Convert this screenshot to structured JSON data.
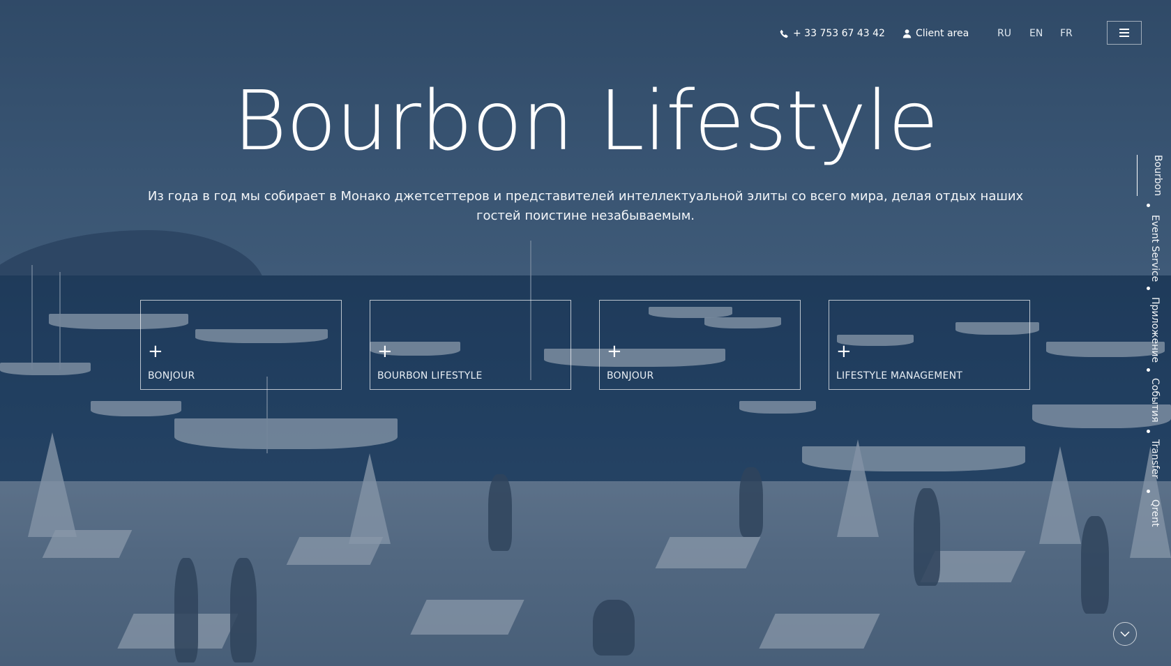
{
  "header": {
    "phone": "+ 33 753 67 43 42",
    "client_area": "Client area",
    "languages": [
      "RU",
      "EN",
      "FR"
    ]
  },
  "hero": {
    "title": "Bourbon Lifestyle",
    "subtitle": "Из года в год мы собирает в Монако джетсеттеров и представителей интеллектуальной элиты со всего мира, делая отдых наших гостей поистине незабываемым."
  },
  "cards": [
    {
      "plus": "+",
      "label": "BONJOUR"
    },
    {
      "plus": "+",
      "label": "BOURBON LIFESTYLE"
    },
    {
      "plus": "+",
      "label": "BONJOUR"
    },
    {
      "plus": "+",
      "label": "LIFESTYLE MANAGEMENT"
    }
  ],
  "sidenav": {
    "items": [
      "Bourbon",
      "Event Service",
      "Приложение",
      "События",
      "Transfer",
      "Qrent"
    ],
    "active": "Bourbon"
  },
  "icons": {
    "phone": "phone-icon",
    "client": "user-icon",
    "menu": "hamburger-icon",
    "scroll": "chevron-down-icon"
  }
}
